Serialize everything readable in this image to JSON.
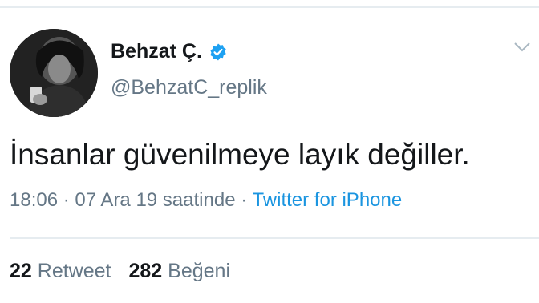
{
  "author": {
    "display_name": "Behzat Ç.",
    "handle": "@BehzatC_replik",
    "verified_icon": "verified-badge-icon",
    "avatar": "profile-photo"
  },
  "menu_icon": "chevron-down-icon",
  "tweet": {
    "text": "İnsanlar güvenilmeye layık değiller."
  },
  "meta": {
    "time": "18:06",
    "separator1": " · ",
    "date": "07 Ara 19 saatinde",
    "separator2": " · ",
    "source": "Twitter for iPhone"
  },
  "stats": {
    "retweet_count": "22",
    "retweet_label": "Retweet",
    "like_count": "282",
    "like_label": "Beğeni"
  },
  "colors": {
    "brand_blue": "#1b95e0",
    "text_primary": "#14171a",
    "text_secondary": "#657786"
  }
}
